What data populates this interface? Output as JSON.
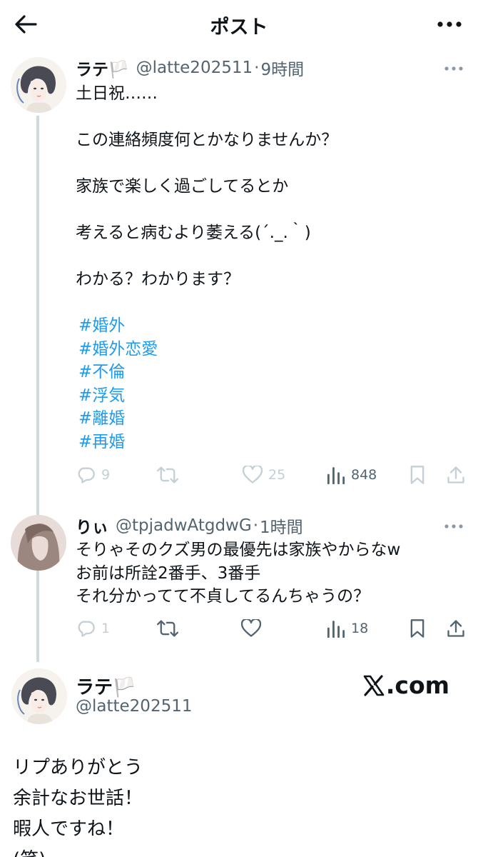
{
  "header": {
    "title": "ポスト"
  },
  "tweet1": {
    "name": "ラテ🏳️",
    "handle": "@latte202511",
    "separator": "·",
    "time": "9時間",
    "line1": "土日祝……",
    "line2": "この連絡頻度何とかなりませんか？",
    "line3": "家族で楽しく過ごしてるとか",
    "line4": "考えると病むより萎える(´._.｀)",
    "line5": "わかる？わかります？",
    "hashtags": [
      "#婚外",
      "#婚外恋愛",
      "#不倫",
      "#浮気",
      "#離婚",
      "#再婚"
    ],
    "stats": {
      "replies": "9",
      "likes": "25",
      "views": "848"
    }
  },
  "tweet2": {
    "name": "りぃ",
    "handle": "@tpjadwAtgdwG",
    "separator": "·",
    "time": "1時間",
    "line1": "そりゃそのクズ男の最優先は家族やからなw",
    "line2": "お前は所詮2番手、3番手",
    "line3": "それ分かってて不貞してるんちゃうの？",
    "stats": {
      "replies": "1",
      "views": "18"
    }
  },
  "quote": {
    "name": "ラテ🏳️",
    "handle": "@latte202511",
    "site": ".com",
    "line1": "リプありがとう",
    "line2": "余計なお世話！",
    "line3": "暇人ですね！",
    "line4": "(笑)"
  },
  "colors": {
    "text": "#0f1419",
    "secondary": "#536471",
    "hashtag": "#1d9bf0",
    "thread_line": "#cfd9de",
    "faded_icon": "#c4cfd6"
  },
  "icons": [
    "back-arrow-icon",
    "more-icon",
    "reply-icon",
    "retweet-icon",
    "like-icon",
    "views-icon",
    "bookmark-icon",
    "share-icon",
    "x-logo-icon"
  ]
}
